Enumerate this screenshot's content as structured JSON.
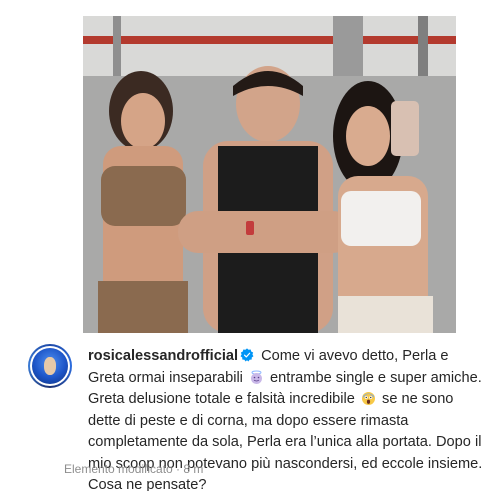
{
  "post": {
    "username": "rosicalessandrofficial",
    "verified_icon": "verified-badge-icon",
    "caption_line1": "Come vi avevo detto, Perla e Greta ormai inseparabili",
    "emoji1": "angel-face-emoji",
    "caption_line2": "entrambe single e super amiche. Greta delusione totale e falsità incredibile",
    "emoji2": "screaming-face-emoji",
    "caption_line3": "se ne sono dette di peste e di corna, ma dopo essere rimasta completamente da sola, Perla era l’unica alla portata. Dopo il mio scoop non potevano più nascondersi, ed eccole insieme. Cosa ne pensate?",
    "meta": "Elemento modificato · 8 m"
  },
  "colors": {
    "text": "#262626",
    "muted": "#8e8e8e",
    "verified": "#0095f6"
  }
}
